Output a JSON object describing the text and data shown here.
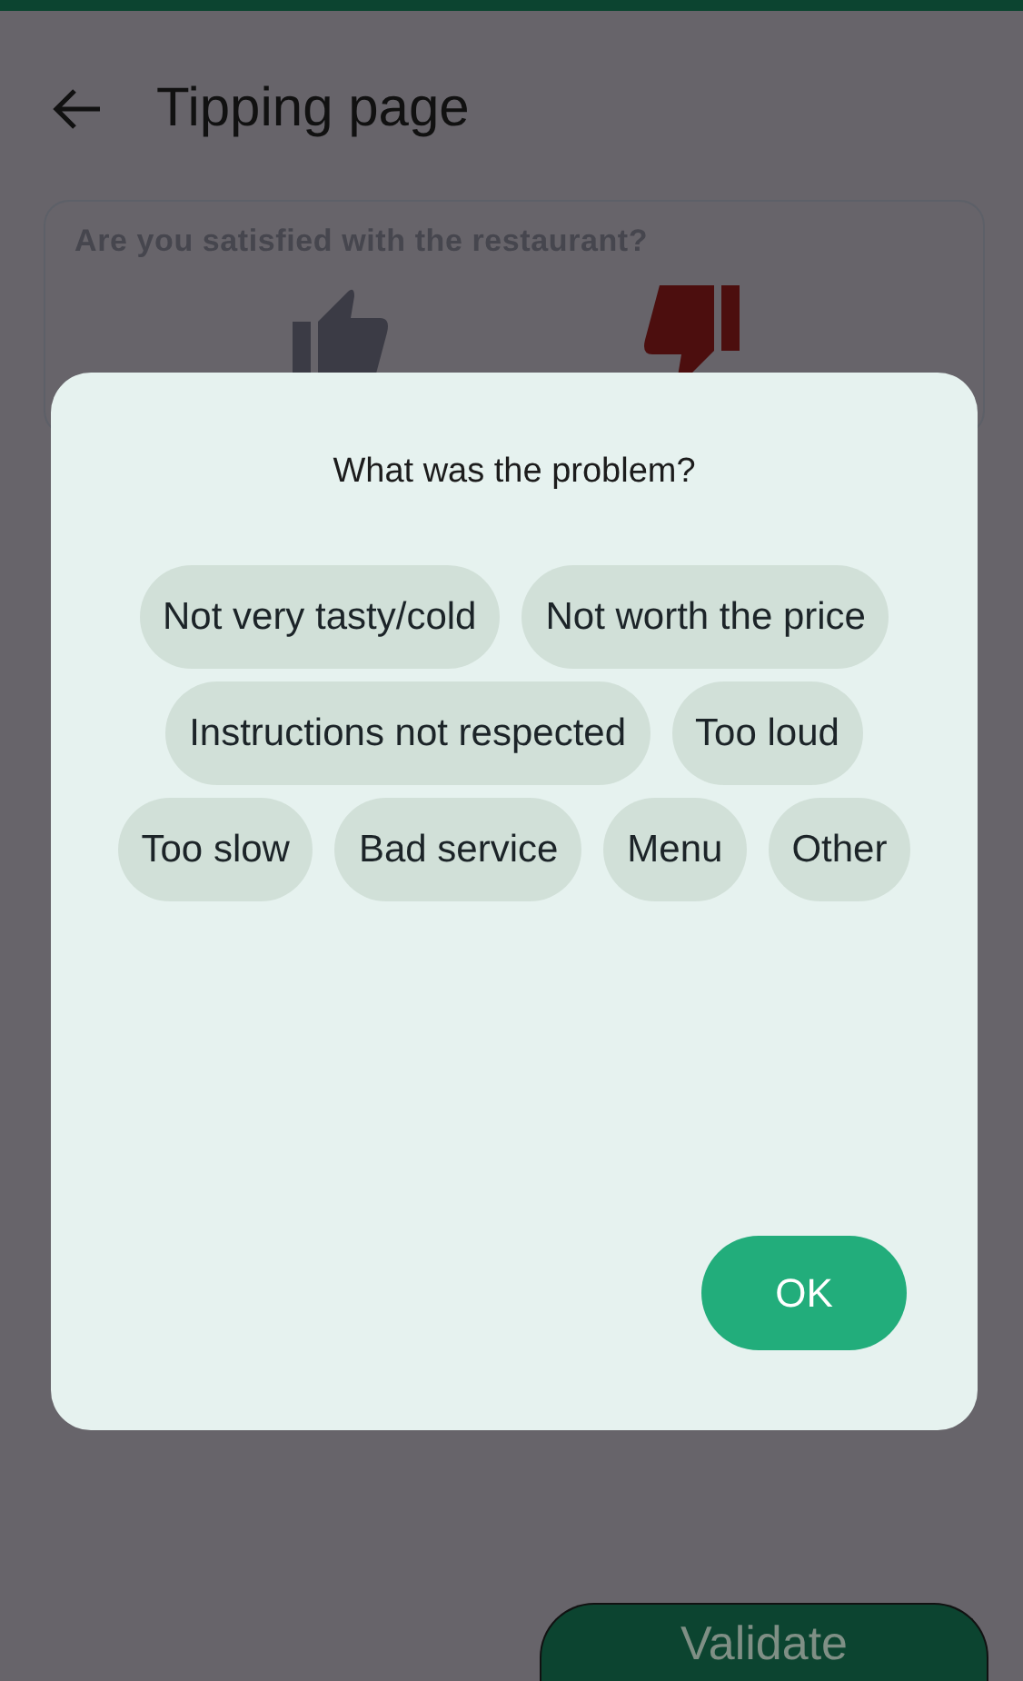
{
  "header": {
    "title": "Tipping page"
  },
  "satisfaction": {
    "question": "Are you satisfied with the restaurant?",
    "choices": [
      {
        "kind": "up",
        "selected": false
      },
      {
        "kind": "down",
        "selected": true
      }
    ]
  },
  "dialog": {
    "title": "What was the problem?",
    "reasons": [
      {
        "label": "Not very tasty/cold",
        "selected": false
      },
      {
        "label": "Not worth the price",
        "selected": false
      },
      {
        "label": "Instructions not respected",
        "selected": false
      },
      {
        "label": "Too loud",
        "selected": false
      },
      {
        "label": "Too slow",
        "selected": false
      },
      {
        "label": "Bad service",
        "selected": false
      },
      {
        "label": "Menu",
        "selected": false
      },
      {
        "label": "Other",
        "selected": false
      }
    ],
    "ok": "OK"
  },
  "validate": "Validate"
}
